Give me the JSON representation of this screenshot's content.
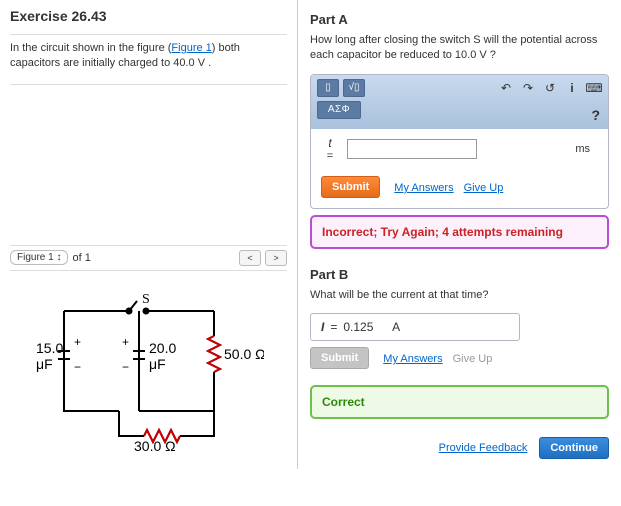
{
  "exercise": {
    "title": "Exercise 26.43",
    "prompt_pre": "In the circuit shown in the figure (",
    "prompt_link": "Figure 1",
    "prompt_post": ") both capacitors are initially charged to 40.0 V ."
  },
  "figure_selector": {
    "label": "Figure 1",
    "of_text": "of 1"
  },
  "circuit": {
    "switch_label": "S",
    "cap1_value": "15.0",
    "cap1_unit": "μF",
    "cap2_value": "20.0",
    "cap2_unit": "μF",
    "res1_value": "50.0 Ω",
    "res2_value": "30.0 Ω"
  },
  "partA": {
    "title": "Part A",
    "question": "How long after closing the switch S will the potential across each capacitor be reduced to 10.0 V ?",
    "toolbar_greek": "ΑΣΦ",
    "var": "t",
    "equals": "=",
    "input_value": "",
    "unit": "ms",
    "submit": "Submit",
    "my_answers": "My Answers",
    "give_up": "Give Up",
    "feedback": "Incorrect; Try Again; 4 attempts remaining",
    "help": "?"
  },
  "partB": {
    "title": "Part B",
    "question": "What will be the current at that time?",
    "var": "I",
    "equals": "=",
    "value": "0.125",
    "unit": "A",
    "submit": "Submit",
    "my_answers": "My Answers",
    "give_up": "Give Up",
    "feedback": "Correct"
  },
  "footer": {
    "provide_feedback": "Provide Feedback",
    "continue": "Continue"
  }
}
